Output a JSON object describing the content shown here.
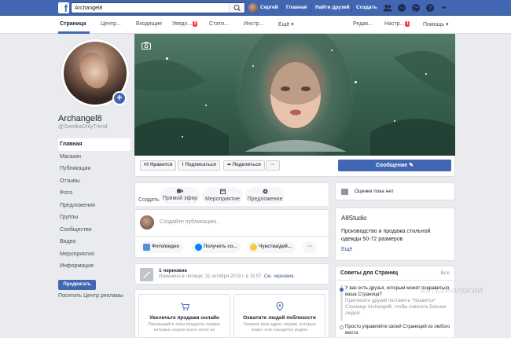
{
  "topbar": {
    "search_value": "Archangel8",
    "user_name": "Сергей",
    "links": [
      "Главная",
      "Найти друзей",
      "Создать"
    ]
  },
  "subnav": {
    "tabs": [
      "Страница",
      "Центр...",
      "Входящие",
      "Уведо...",
      "Стати...",
      "Инстр...",
      "Ещё ▾"
    ],
    "notif_badge": "3",
    "right": [
      "Редак...",
      "Настр...",
      "Помощь ▾"
    ],
    "settings_badge": "1"
  },
  "profile": {
    "name": "Archangel8",
    "handle": "@SvetikaOnlyTrend"
  },
  "left_nav": [
    "Главная",
    "Магазин",
    "Публикации",
    "Отзывы",
    "Фото",
    "Предложения",
    "Группы",
    "Сообщество",
    "Видео",
    "Мероприятия",
    "Информация"
  ],
  "promote_label": "Продвигать",
  "ads_center_label": "Посетить Центр рекламы",
  "actions": {
    "like": "Нравится",
    "follow": "Подписаться",
    "share": "Поделиться",
    "more": "···",
    "message": "Сообщение"
  },
  "create": {
    "tabs": [
      "Создать",
      "Прямой эфир",
      "Мероприятие",
      "Предложение"
    ],
    "placeholder": "Создайте публикацию...",
    "chips": [
      "Фото/видео",
      "Получить со...",
      "Чувства/дей...",
      "···"
    ]
  },
  "draft": {
    "title": "1 черновик",
    "meta": "Изменено в Четверг, 31 октября 2019 г. в 15:57.",
    "link": "См. черновик."
  },
  "promo_cards": [
    {
      "title": "Увеличьте продажи онлайн",
      "text": "Показывайте свои продукты людям, которые скорее всего хотят их"
    },
    {
      "title": "Охватите людей поблизости",
      "text": "Укажите ваш адрес людям, которые живут или находятся рядом"
    }
  ],
  "reviews": "Оценки пока нет",
  "about": {
    "name": "A8Studio",
    "desc": "Производство и продажа стильной одежды 50-72 размеров",
    "more": "Ещё"
  },
  "tips": {
    "title": "Советы для Страниц",
    "all": "Все",
    "item1_title": "У вас есть друзья, которым может понравиться ваша Страница?",
    "item1_text": "Пригласите друзей поставить \"Нравится\" Странице Archangel8, чтобы охватить больше людей.",
    "item2_title": "Просто управляйте своей Страницей из любого места"
  },
  "watermark": "А8ТЕХНОЛОГИИ"
}
